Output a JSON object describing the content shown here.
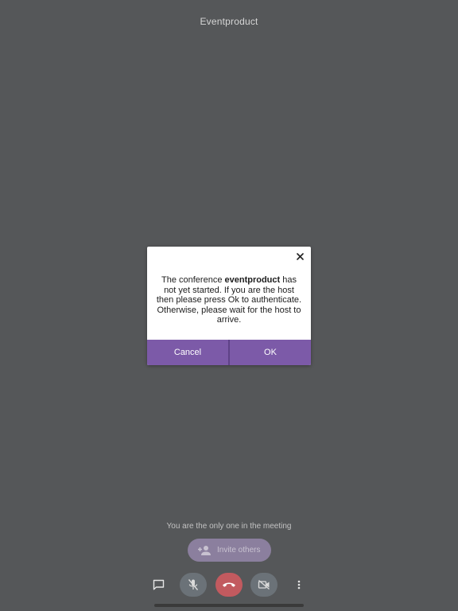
{
  "header": {
    "title": "Eventproduct"
  },
  "dialog": {
    "message_before": "The conference ",
    "conference_name": "eventproduct",
    "message_after": " has not yet started. If you are the host then please press Ok to authenticate. Otherwise, please wait for the host to arrive.",
    "cancel_label": "Cancel",
    "ok_label": "OK",
    "close_icon": "close-icon"
  },
  "main": {
    "alone_message": "You are the only one in the meeting",
    "invite_label": "Invite others",
    "invite_icon": "person-add-icon"
  },
  "toolbar": {
    "chat_icon": "chat-icon",
    "mic_icon": "mic-off-icon",
    "hangup_icon": "hangup-icon",
    "camera_icon": "camera-off-icon",
    "more_icon": "more-vertical-icon"
  },
  "colors": {
    "background": "#555759",
    "accent": "#7c5aa8",
    "hangup": "#c25a5f",
    "control_bg": "#6b7278"
  }
}
